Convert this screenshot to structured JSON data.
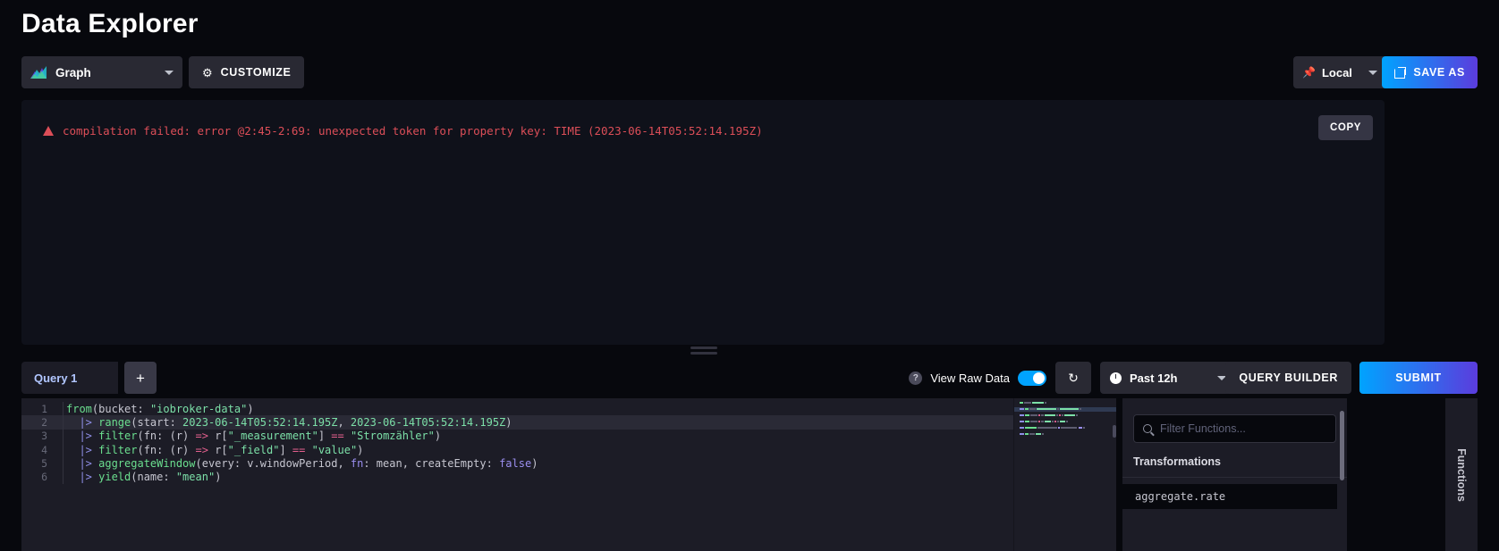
{
  "header": {
    "title": "Data Explorer"
  },
  "toolbar": {
    "viz_label": "Graph",
    "viz_icon": "graph-icon",
    "customize_label": "CUSTOMIZE",
    "customize_icon": "gear-icon",
    "local_label": "Local",
    "local_icon": "pin-icon",
    "save_as_label": "SAVE AS",
    "save_as_icon": "external-link-icon",
    "caret_icon": "chevron-down-icon"
  },
  "graph_panel": {
    "error_icon": "warning-triangle-icon",
    "error_text": "compilation failed: error @2:45-2:69: unexpected token for property key: TIME (2023-06-14T05:52:14.195Z)",
    "copy_label": "COPY"
  },
  "query_toolbar": {
    "query_tab_label": "Query 1",
    "add_query_label": "+",
    "help_icon": "question-mark-icon",
    "raw_data_label": "View Raw Data",
    "raw_data_on": true,
    "refresh_icon": "refresh-icon",
    "time_range_label": "Past 12h",
    "time_icon": "clock-icon",
    "query_builder_label": "QUERY BUILDER",
    "submit_label": "SUBMIT"
  },
  "editor": {
    "lines": [
      {
        "no": "1",
        "active": false,
        "tokens": [
          {
            "t": "from",
            "c": "tk-fn"
          },
          {
            "t": "(bucket: ",
            "c": "tk-pln"
          },
          {
            "t": "\"iobroker-data\"",
            "c": "tk-str"
          },
          {
            "t": ")",
            "c": "tk-pln"
          }
        ]
      },
      {
        "no": "2",
        "active": true,
        "tokens": [
          {
            "t": "  |> ",
            "c": "tk-pipe"
          },
          {
            "t": "range",
            "c": "tk-fn"
          },
          {
            "t": "(start: ",
            "c": "tk-pln"
          },
          {
            "t": "2023-06-14T05:52:14.195Z",
            "c": "tk-num"
          },
          {
            "t": ", ",
            "c": "tk-pln"
          },
          {
            "t": "2023-06-14T05:52:14.195Z",
            "c": "tk-num"
          },
          {
            "t": ")",
            "c": "tk-pln"
          }
        ]
      },
      {
        "no": "3",
        "active": false,
        "tokens": [
          {
            "t": "  |> ",
            "c": "tk-pipe"
          },
          {
            "t": "filter",
            "c": "tk-fn"
          },
          {
            "t": "(fn: (r) ",
            "c": "tk-pln"
          },
          {
            "t": "=>",
            "c": "tk-op"
          },
          {
            "t": " r[",
            "c": "tk-pln"
          },
          {
            "t": "\"_measurement\"",
            "c": "tk-str"
          },
          {
            "t": "] ",
            "c": "tk-pln"
          },
          {
            "t": "==",
            "c": "tk-op"
          },
          {
            "t": " ",
            "c": "tk-pln"
          },
          {
            "t": "\"Stromzähler\"",
            "c": "tk-str"
          },
          {
            "t": ")",
            "c": "tk-pln"
          }
        ]
      },
      {
        "no": "4",
        "active": false,
        "tokens": [
          {
            "t": "  |> ",
            "c": "tk-pipe"
          },
          {
            "t": "filter",
            "c": "tk-fn"
          },
          {
            "t": "(fn: (r) ",
            "c": "tk-pln"
          },
          {
            "t": "=>",
            "c": "tk-op"
          },
          {
            "t": " r[",
            "c": "tk-pln"
          },
          {
            "t": "\"_field\"",
            "c": "tk-str"
          },
          {
            "t": "] ",
            "c": "tk-pln"
          },
          {
            "t": "==",
            "c": "tk-op"
          },
          {
            "t": " ",
            "c": "tk-pln"
          },
          {
            "t": "\"value\"",
            "c": "tk-str"
          },
          {
            "t": ")",
            "c": "tk-pln"
          }
        ]
      },
      {
        "no": "5",
        "active": false,
        "tokens": [
          {
            "t": "  |> ",
            "c": "tk-pipe"
          },
          {
            "t": "aggregateWindow",
            "c": "tk-fn"
          },
          {
            "t": "(every: v.windowPeriod, ",
            "c": "tk-pln"
          },
          {
            "t": "fn",
            "c": "tk-kw"
          },
          {
            "t": ": mean, createEmpty: ",
            "c": "tk-pln"
          },
          {
            "t": "false",
            "c": "tk-kw"
          },
          {
            "t": ")",
            "c": "tk-pln"
          }
        ]
      },
      {
        "no": "6",
        "active": false,
        "tokens": [
          {
            "t": "  |> ",
            "c": "tk-pipe"
          },
          {
            "t": "yield",
            "c": "tk-fn"
          },
          {
            "t": "(name: ",
            "c": "tk-pln"
          },
          {
            "t": "\"mean\"",
            "c": "tk-str"
          },
          {
            "t": ")",
            "c": "tk-pln"
          }
        ]
      }
    ]
  },
  "functions_panel": {
    "search_placeholder": "Filter Functions...",
    "search_value": "",
    "search_icon": "search-icon",
    "section_title": "Transformations",
    "items": [
      {
        "label": "aggregate.rate"
      }
    ],
    "tab_label": "Functions"
  },
  "colors": {
    "accent_blue": "#00a3ff",
    "accent_purple": "#5b3cdd",
    "error_red": "#dc4e58",
    "panel_bg": "#1c1c26",
    "page_bg": "#07080d"
  }
}
